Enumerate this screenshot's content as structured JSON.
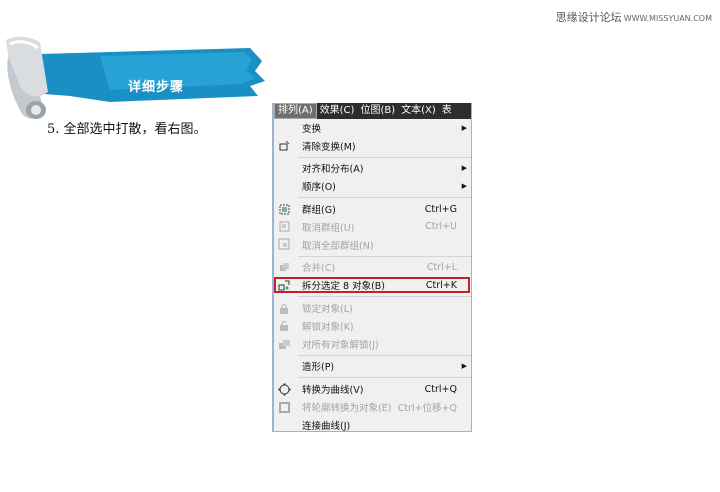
{
  "watermark": {
    "site": "思缘设计论坛",
    "url": "WWW.MISSYUAN.COM"
  },
  "banner": {
    "title": "详细步骤"
  },
  "step": {
    "text": "5. 全部选中打散，看右图。"
  },
  "menubar": {
    "items": [
      {
        "label": "排列(A)",
        "active": true
      },
      {
        "label": "效果(C)",
        "active": false
      },
      {
        "label": "位图(B)",
        "active": false
      },
      {
        "label": "文本(X)",
        "active": false
      },
      {
        "label": "表",
        "active": false
      }
    ]
  },
  "menu": {
    "items": [
      {
        "label": "变换",
        "shortcut": "",
        "submenu": true,
        "disabled": false,
        "icon": ""
      },
      {
        "label": "清除变换(M)",
        "shortcut": "",
        "submenu": false,
        "disabled": false,
        "icon": "clear-transform-icon"
      },
      {
        "sep": true
      },
      {
        "label": "对齐和分布(A)",
        "shortcut": "",
        "submenu": true,
        "disabled": false,
        "icon": ""
      },
      {
        "label": "顺序(O)",
        "shortcut": "",
        "submenu": true,
        "disabled": false,
        "icon": ""
      },
      {
        "sep": true
      },
      {
        "label": "群组(G)",
        "shortcut": "Ctrl+G",
        "submenu": false,
        "disabled": false,
        "icon": "group-icon"
      },
      {
        "label": "取消群组(U)",
        "shortcut": "Ctrl+U",
        "submenu": false,
        "disabled": true,
        "icon": "ungroup-icon"
      },
      {
        "label": "取消全部群组(N)",
        "shortcut": "",
        "submenu": false,
        "disabled": true,
        "icon": "ungroup-all-icon"
      },
      {
        "sep": true
      },
      {
        "label": "合并(C)",
        "shortcut": "Ctrl+L",
        "submenu": false,
        "disabled": true,
        "icon": "combine-icon"
      },
      {
        "label": "拆分选定 8 对象(B)",
        "shortcut": "Ctrl+K",
        "submenu": false,
        "disabled": false,
        "icon": "break-apart-icon",
        "highlighted": true
      },
      {
        "sep": true
      },
      {
        "label": "锁定对象(L)",
        "shortcut": "",
        "submenu": false,
        "disabled": true,
        "icon": "lock-icon"
      },
      {
        "label": "解锁对象(K)",
        "shortcut": "",
        "submenu": false,
        "disabled": true,
        "icon": "unlock-icon"
      },
      {
        "label": "对所有对象解锁(J)",
        "shortcut": "",
        "submenu": false,
        "disabled": true,
        "icon": "unlock-all-icon"
      },
      {
        "sep": true
      },
      {
        "label": "造形(P)",
        "shortcut": "",
        "submenu": true,
        "disabled": false,
        "icon": ""
      },
      {
        "sep": true
      },
      {
        "label": "转换为曲线(V)",
        "shortcut": "Ctrl+Q",
        "submenu": false,
        "disabled": false,
        "icon": "convert-to-curves-icon"
      },
      {
        "label": "将轮廓转换为对象(E)",
        "shortcut": "Ctrl+位移+Q",
        "submenu": false,
        "disabled": true,
        "icon": "outline-to-object-icon"
      },
      {
        "label": "连接曲线(J)",
        "shortcut": "",
        "submenu": false,
        "disabled": false,
        "icon": ""
      }
    ]
  },
  "colors": {
    "highlight_border": "#c0212a",
    "banner_blue": "#1a8fc4"
  }
}
